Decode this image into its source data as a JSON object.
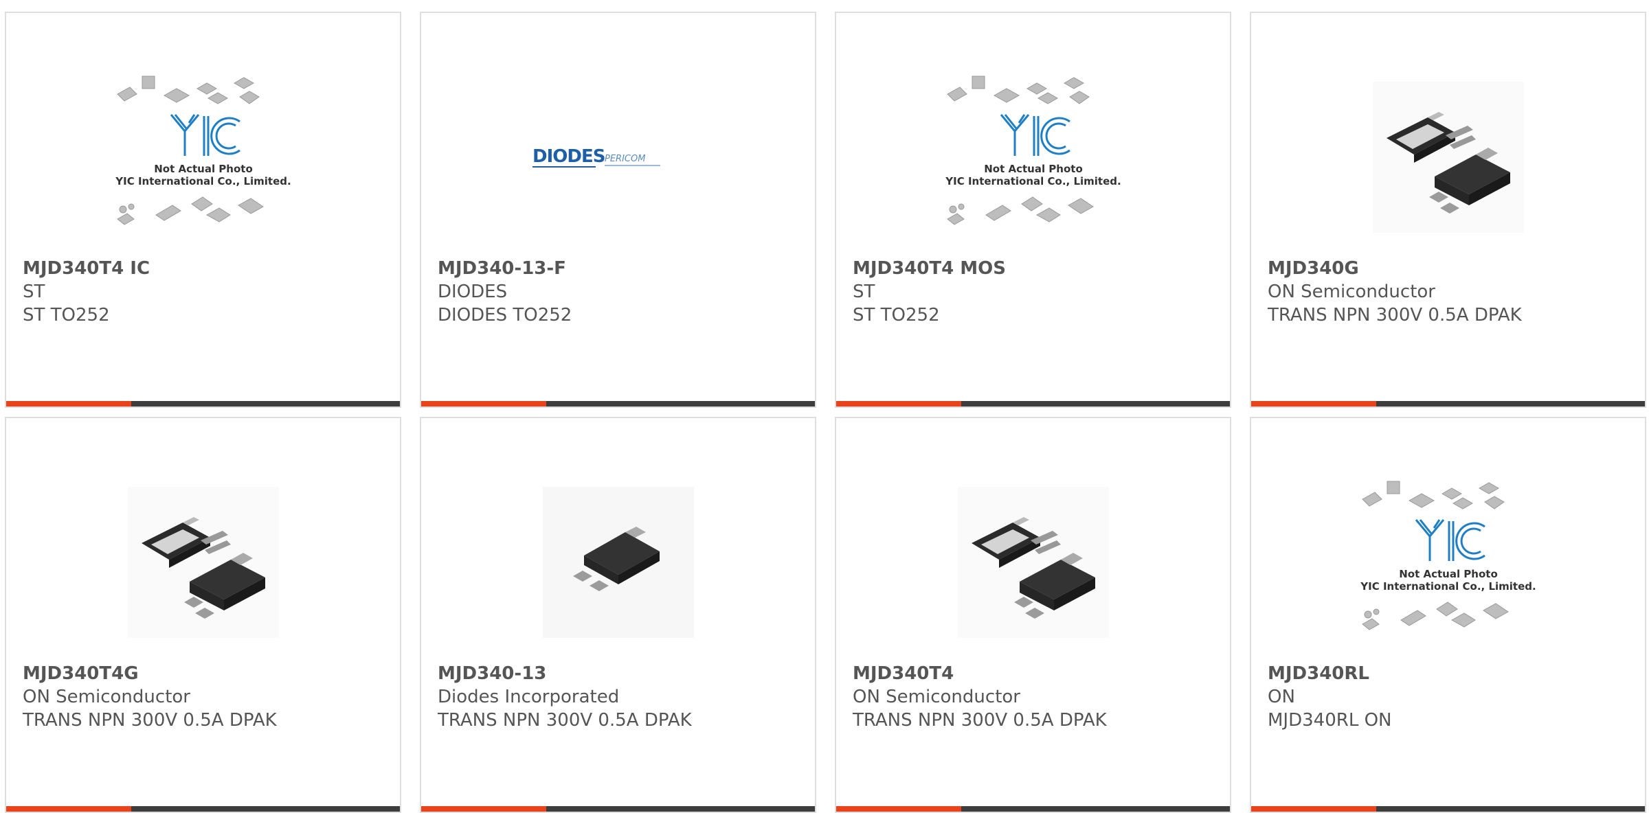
{
  "colors": {
    "accent": "#e8431b",
    "bar": "#3d3d3d",
    "border": "#dedede",
    "text": "#555555"
  },
  "cards": [
    {
      "part": "MJD340T4 IC",
      "manufacturer": "ST",
      "description": "ST TO252",
      "image": "yic-placeholder-icon"
    },
    {
      "part": "MJD340-13-F",
      "manufacturer": "DIODES",
      "description": "DIODES TO252",
      "image": "diodes-logo-icon"
    },
    {
      "part": "MJD340T4 MOS",
      "manufacturer": "ST",
      "description": "ST TO252",
      "image": "yic-placeholder-icon"
    },
    {
      "part": "MJD340G",
      "manufacturer": "ON Semiconductor",
      "description": "TRANS NPN 300V 0.5A DPAK",
      "image": "dpak-pair-icon"
    },
    {
      "part": "MJD340T4G",
      "manufacturer": "ON Semiconductor",
      "description": "TRANS NPN 300V 0.5A DPAK",
      "image": "dpak-pair-icon"
    },
    {
      "part": "MJD340-13",
      "manufacturer": "Diodes Incorporated",
      "description": "TRANS NPN 300V 0.5A DPAK",
      "image": "dpak-single-icon"
    },
    {
      "part": "MJD340T4",
      "manufacturer": "ON Semiconductor",
      "description": "TRANS NPN 300V 0.5A DPAK",
      "image": "dpak-pair-icon"
    },
    {
      "part": "MJD340RL",
      "manufacturer": "ON",
      "description": "MJD340RL ON",
      "image": "yic-placeholder-icon"
    }
  ],
  "yic_placeholder": {
    "logo": "YIC",
    "line1": "Not Actual Photo",
    "line2": "YIC International Co., Limited."
  },
  "diodes_logo": {
    "brand": "DIODES",
    "sub": "PERICOM"
  }
}
